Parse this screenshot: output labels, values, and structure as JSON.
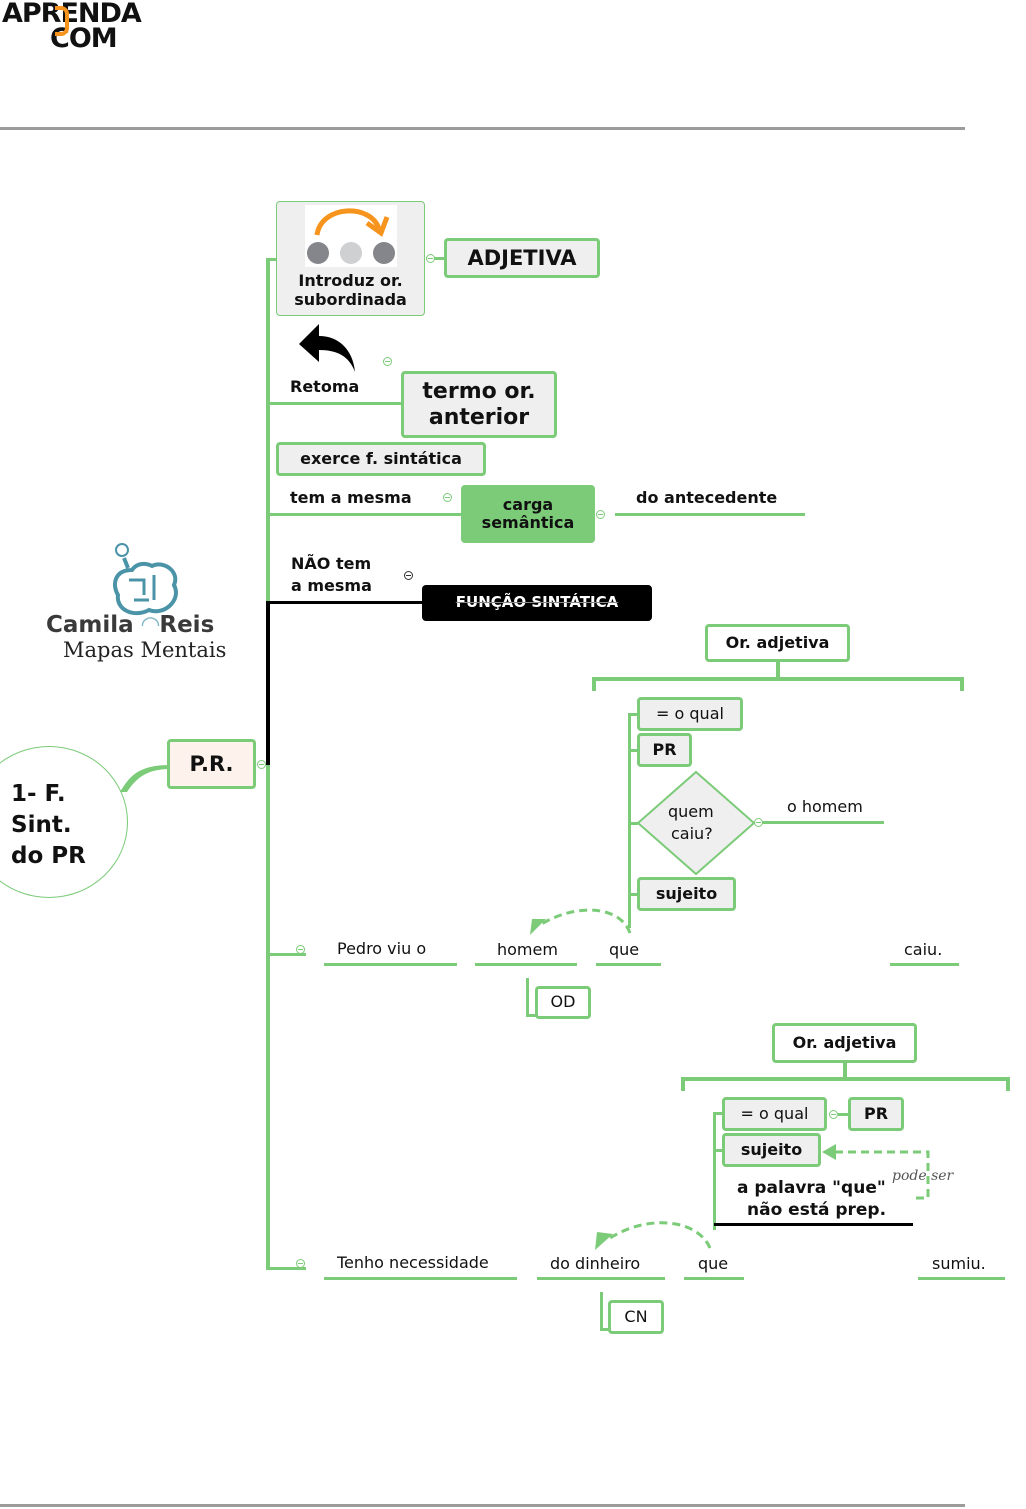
{
  "header": {
    "brand_line1": "APRENDA",
    "brand_line2": "COM",
    "brand_accent": "#f7941d"
  },
  "watermark": {
    "name_part1": "Camila",
    "name_part2": "Reis",
    "subtitle": "Mapas Mentais",
    "icon": "brain-lightbulb-icon"
  },
  "colors": {
    "branch_green": "#7bcb78",
    "node_fill": "#efefef",
    "root_fill": "#fdf3ec",
    "dark_node": "#000000"
  },
  "map": {
    "central_topic": [
      "1- F.",
      "Sint.",
      "do PR"
    ],
    "main_node": "P.R.",
    "branches": {
      "introduz": {
        "label_line1": "Introduz or.",
        "label_line2": "subordinada",
        "target": "ADJETIVA"
      },
      "retoma": {
        "label": "Retoma",
        "target_line1": "termo or.",
        "target_line2": "anterior"
      },
      "exerce": {
        "label": "exerce f. sintática"
      },
      "tem_mesma": {
        "label": "tem a mesma",
        "target_line1": "carga",
        "target_line2": "semântica",
        "after": "do antecedente"
      },
      "nao_tem": {
        "label_line1": "NÃO tem",
        "label_line2": "a mesma",
        "target": "FUNÇÃO SINTÁTICA"
      }
    },
    "example1": {
      "header": "Or. adjetiva",
      "items": [
        "= o qual",
        "PR",
        "sujeito"
      ],
      "question_line1": "quem",
      "question_line2": "caiu?",
      "answer": "o homem",
      "sentence": [
        "Pedro viu o",
        "homem",
        "que",
        "caiu."
      ],
      "function_tag": "OD"
    },
    "example2": {
      "header": "Or. adjetiva",
      "items": [
        "= o qual",
        "sujeito"
      ],
      "pr_tag": "PR",
      "note_line1": "a palavra \"que\"",
      "note_line2": "não está prep.",
      "relation_label": "pode ser",
      "sentence": [
        "Tenho necessidade",
        "do dinheiro",
        "que",
        "sumiu."
      ],
      "function_tag": "CN"
    }
  }
}
